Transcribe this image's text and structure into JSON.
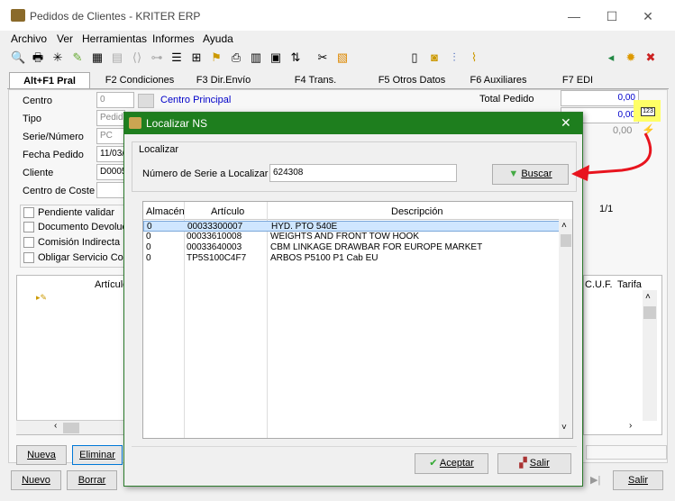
{
  "window": {
    "title": "Pedidos de Clientes - KRITER ERP",
    "minimize": "—",
    "maximize": "☐",
    "close": "✕"
  },
  "menu": [
    "Archivo",
    "Ver",
    "Herramientas",
    "Informes",
    "Ayuda"
  ],
  "tabs": [
    "Alt+F1 Pral",
    "F2 Condiciones",
    "F3 Dir.Envío",
    "F4 Trans.",
    "F5 Otros Datos",
    "F6 Auxiliares",
    "F7 EDI"
  ],
  "form": {
    "centro_label": "Centro",
    "centro_value": "0",
    "centro_name": "Centro Principal",
    "tipo_label": "Tipo",
    "tipo_value": "Pedido",
    "serie_label": "Serie/Número",
    "serie_value": "PC",
    "fecha_label": "Fecha Pedido",
    "fecha_value": "11/03/",
    "cliente_label": "Cliente",
    "cliente_value": "D0005",
    "coste_label": "Centro de Coste"
  },
  "totals": {
    "total_label": "Total Pedido",
    "total_value": "0,00",
    "value2": "0,00",
    "value3": "0,00",
    "pager": "1/1"
  },
  "checks": [
    "Pendiente validar",
    "Documento Devolución",
    "Comisión Indirecta",
    "Obligar Servicio Completo"
  ],
  "lines_grid": {
    "col_articulo": "Artículo",
    "col_cuf": "C.U.F.",
    "col_tarifa": "Tarifa"
  },
  "bottom_buttons": {
    "nueva": "Nueva",
    "eliminar": "Eliminar",
    "nuevo": "Nuevo",
    "borrar": "Borrar",
    "salir": "Salir"
  },
  "dialog": {
    "title": "Localizar NS",
    "group_label": "Localizar",
    "serie_label": "Número de Serie a Localizar",
    "serie_value": "624308",
    "buscar": "Buscar",
    "headers": {
      "almacen": "Almacén",
      "articulo": "Artículo",
      "descripcion": "Descripción"
    },
    "rows": [
      {
        "almacen": "0",
        "articulo": "00033300007",
        "descripcion": "HYD. PTO 540E"
      },
      {
        "almacen": "0",
        "articulo": "00033610008",
        "descripcion": "WEIGHTS AND FRONT TOW HOOK"
      },
      {
        "almacen": "0",
        "articulo": "00033640003",
        "descripcion": "CBM LINKAGE DRAWBAR FOR EUROPE MARKET"
      },
      {
        "almacen": "0",
        "articulo": "TP5S100C4F7",
        "descripcion": "ARBOS P5100 P1 Cab EU"
      }
    ],
    "aceptar": "Aceptar",
    "salir": "Salir"
  },
  "colors": {
    "dialog_title": "#1e7e1e",
    "arrow": "#e8141e",
    "highlight": "#ffff66",
    "selected_row": "#cfe6ff"
  }
}
